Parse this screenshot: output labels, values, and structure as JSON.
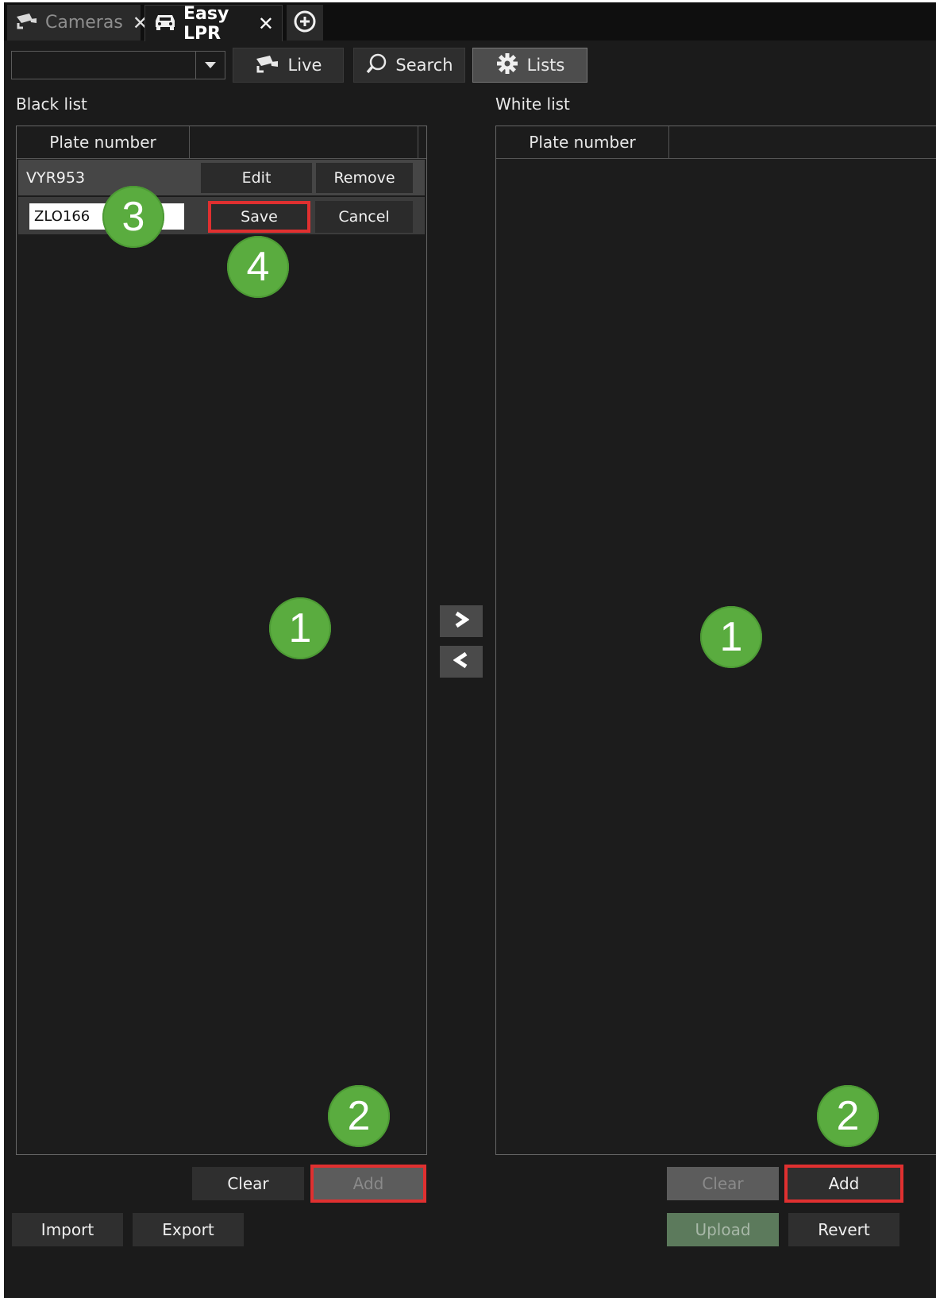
{
  "tabs": [
    {
      "label": "Cameras",
      "close": "✕"
    },
    {
      "label": "Easy LPR",
      "close": "✕"
    }
  ],
  "toolbar": {
    "selector_value": "",
    "live_label": "Live",
    "search_label": "Search",
    "lists_label": "Lists"
  },
  "black_list": {
    "title": "Black list",
    "column_header": "Plate number",
    "rows": [
      {
        "plate": "VYR953",
        "edit_label": "Edit",
        "remove_label": "Remove"
      }
    ],
    "edit_row": {
      "value": "ZLO166",
      "save_label": "Save",
      "cancel_label": "Cancel"
    },
    "clear_label": "Clear",
    "add_label": "Add",
    "import_label": "Import",
    "export_label": "Export"
  },
  "white_list": {
    "title": "White list",
    "column_header": "Plate number",
    "clear_label": "Clear",
    "add_label": "Add",
    "upload_label": "Upload",
    "revert_label": "Revert"
  },
  "move_buttons": {
    "right": ">",
    "left": "<"
  },
  "annotations": {
    "step1": "1",
    "step2": "2",
    "step3": "3",
    "step4": "4",
    "badge_color": "#5aac3f",
    "highlight_color": "#e03030"
  }
}
